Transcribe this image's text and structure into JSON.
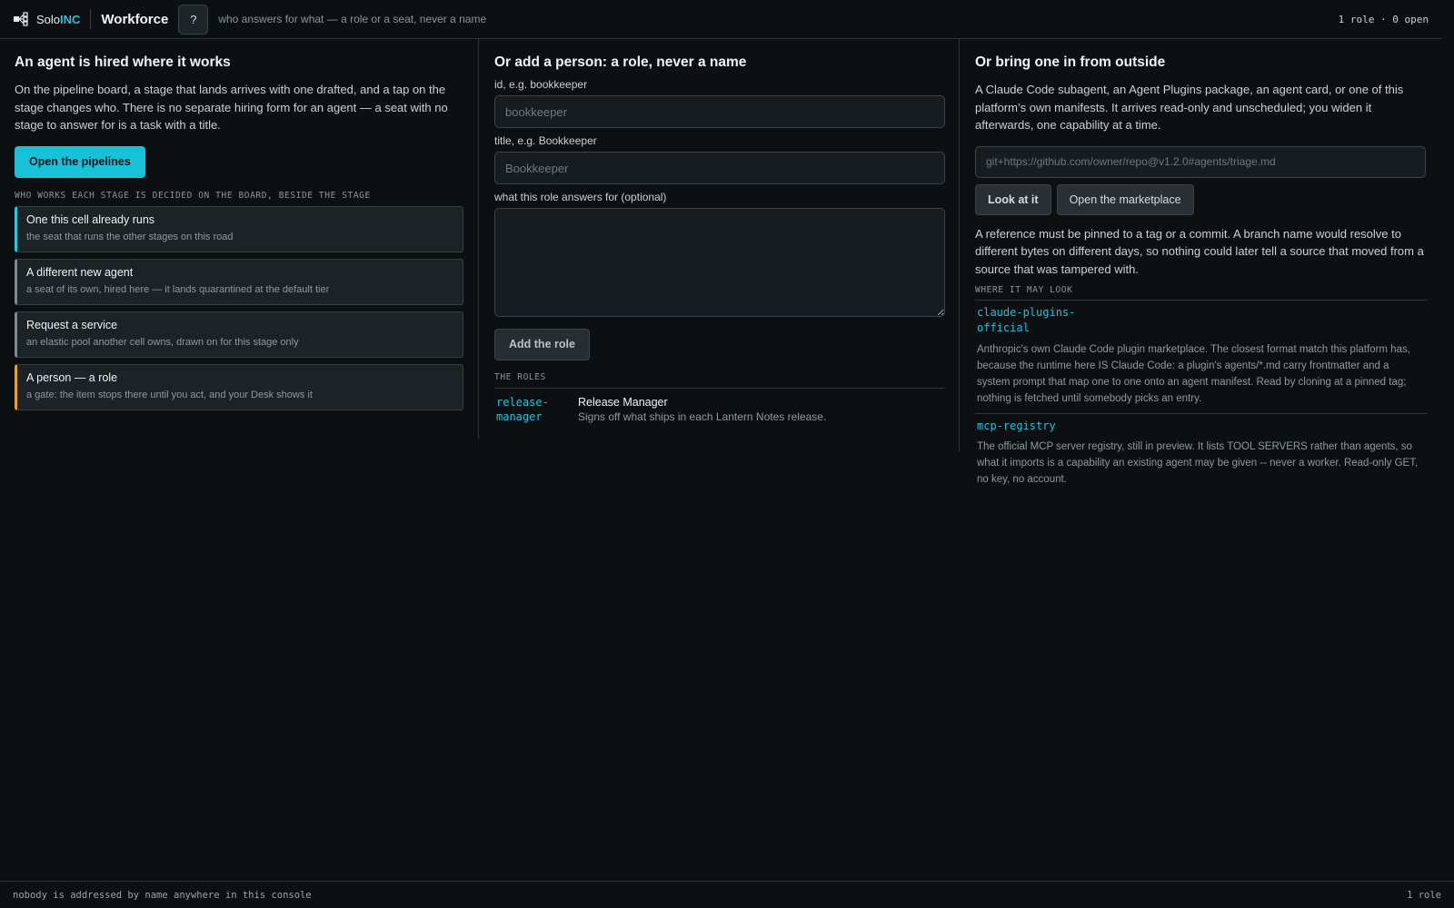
{
  "header": {
    "brand_prefix": "Solo",
    "brand_accent": "INC",
    "section": "Workforce",
    "help_label": "?",
    "tagline": "who answers for what — a role or a seat, never a name",
    "status": "1 role · 0 open"
  },
  "hire": {
    "title": "An agent is hired where it works",
    "body": "On the pipeline board, a stage that lands arrives with one drafted, and a tap on the stage changes who. There is no separate hiring form for an agent — a seat with no stage to answer for is a task with a title.",
    "open_button": "Open the pipelines",
    "section_label": "WHO WORKS EACH STAGE IS DECIDED ON THE BOARD, BESIDE THE STAGE",
    "options": [
      {
        "title": "One this cell already runs",
        "subtitle": "the seat that runs the other stages on this road",
        "accent": "#2ec4dc"
      },
      {
        "title": "A different new agent",
        "subtitle": "a seat of its own, hired here — it lands quarantined at the default tier",
        "accent": "#7e8a91"
      },
      {
        "title": "Request a service",
        "subtitle": "an elastic pool another cell owns, drawn on for this stage only",
        "accent": "#7e8a91"
      },
      {
        "title": "A person — a role",
        "subtitle": "a gate: the item stops there until you act, and your Desk shows it",
        "accent": "#e2a32c"
      }
    ]
  },
  "add_person": {
    "title": "Or add a person: a role, never a name",
    "id_label": "id, e.g. bookkeeper",
    "id_placeholder": "bookkeeper",
    "title_label": "title, e.g. Bookkeeper",
    "title_placeholder": "Bookkeeper",
    "answers_label": "what this role answers for (optional)",
    "answers_value": "",
    "add_button": "Add the role",
    "roles_label": "THE ROLES",
    "roles": [
      {
        "id": "release-\nmanager",
        "title": "Release Manager",
        "description": "Signs off what ships in each Lantern Notes release."
      }
    ]
  },
  "outside": {
    "title": "Or bring one in from outside",
    "body": "A Claude Code subagent, an Agent Plugins package, an agent card, or one of this platform’s own manifests. It arrives read-only and unscheduled; you widen it afterwards, one capability at a time.",
    "url_placeholder": "git+https://github.com/owner/repo@v1.2.0#agents/triage.md",
    "look_button": "Look at it",
    "marketplace_button": "Open the marketplace",
    "pin_note": "A reference must be pinned to a tag or a commit. A branch name would resolve to different bytes on different days, so nothing could later tell a source that moved from a source that was tampered with.",
    "sources_label": "WHERE IT MAY LOOK",
    "sources": [
      {
        "id": "claude-plugins-\nofficial",
        "description": "Anthropic's own Claude Code plugin marketplace. The closest format match this platform has, because the runtime here IS Claude Code: a plugin's agents/*.md carry frontmatter and a system prompt that map one to one onto an agent manifest. Read by cloning at a pinned tag; nothing is fetched until somebody picks an entry."
      },
      {
        "id": "mcp-registry",
        "description": "The official MCP server registry, still in preview. It lists TOOL SERVERS rather than agents, so what it imports is a capability an existing agent may be given -- never a worker. Read-only GET, no key, no account."
      }
    ]
  },
  "footer": {
    "left": "nobody is addressed by name anywhere in this console",
    "right": "1 role"
  },
  "colors": {
    "accent": "#17c2d9",
    "background": "#0c1013",
    "gate": "#e2a32c"
  }
}
